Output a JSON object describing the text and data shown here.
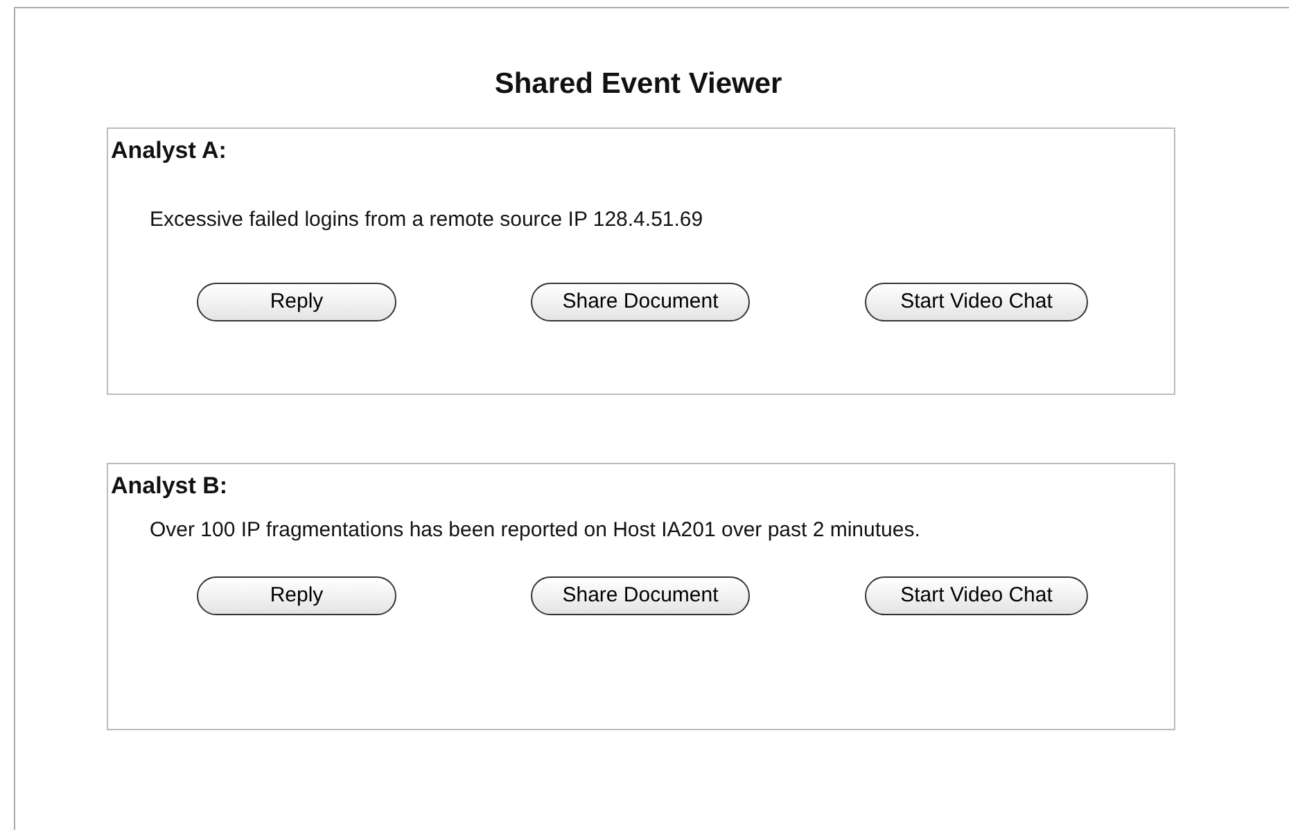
{
  "title": "Shared Event Viewer",
  "panels": [
    {
      "analyst": "Analyst A:",
      "message": "Excessive failed logins from a remote source IP 128.4.51.69",
      "buttons": [
        "Reply",
        "Share Document",
        "Start Video Chat"
      ]
    },
    {
      "analyst": "Analyst B:",
      "message": "Over 100 IP fragmentations has been reported on Host IA201 over past 2 minutues.",
      "buttons": [
        "Reply",
        "Share Document",
        "Start Video Chat"
      ]
    }
  ]
}
